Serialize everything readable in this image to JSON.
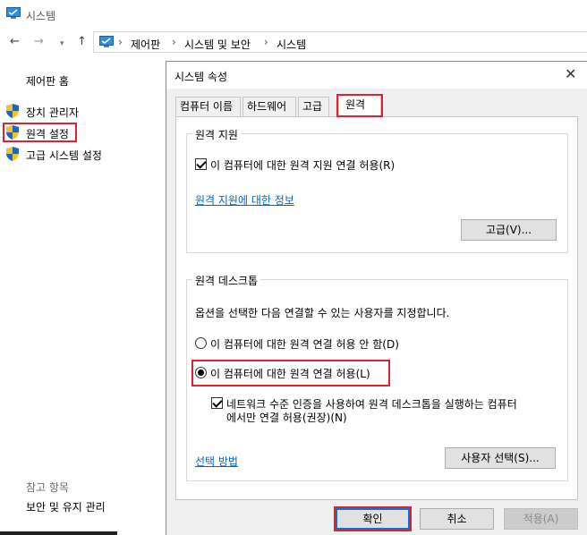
{
  "window": {
    "title": "시스템"
  },
  "address_bar": {
    "crumbs": [
      "제어판",
      "시스템 및 보안",
      "시스템"
    ]
  },
  "sidebar": {
    "home": "제어판 홈",
    "links": [
      "장치 관리자",
      "원격 설정",
      "고급 시스템 설정"
    ],
    "see_also_title": "참고 항목",
    "see_also_links": [
      "보안 및 유지 관리"
    ]
  },
  "dialog": {
    "title": "시스템 속성",
    "tabs": [
      "컴퓨터 이름",
      "하드웨어",
      "고급",
      "원격"
    ],
    "active_tab": "원격",
    "remote_assistance": {
      "group_label": "원격 지원",
      "allow_label": "이 컴퓨터에 대한 원격 지원 연결 허용(R)",
      "allow_checked": true,
      "info_link": "원격 지원에 대한 정보",
      "advanced_button": "고급(V)..."
    },
    "remote_desktop": {
      "group_label": "원격 데스크톱",
      "description": "옵션을 선택한 다음 연결할 수 있는 사용자를 지정합니다.",
      "option_deny": "이 컴퓨터에 대한 원격 연결 허용 안 함(D)",
      "option_allow": "이 컴퓨터에 대한 원격 연결 허용(L)",
      "selected_option": "allow",
      "nla_label_line1": "네트워크 수준 인증을 사용하여 원격 데스크톱을 실행하는 컴퓨터",
      "nla_label_line2": "에서만 연결 허용(권장)(N)",
      "nla_checked": true,
      "help_link": "선택 방법",
      "select_users_button": "사용자 선택(S)..."
    },
    "buttons": {
      "ok": "확인",
      "cancel": "취소",
      "apply": "적용(A)"
    }
  },
  "colors": {
    "highlight_red": "#e3202d",
    "link_blue": "#0066cc",
    "primary_border": "#0078d7"
  },
  "icons": {
    "app": "system-monitor-icon",
    "shield": "uac-shield-icon"
  }
}
